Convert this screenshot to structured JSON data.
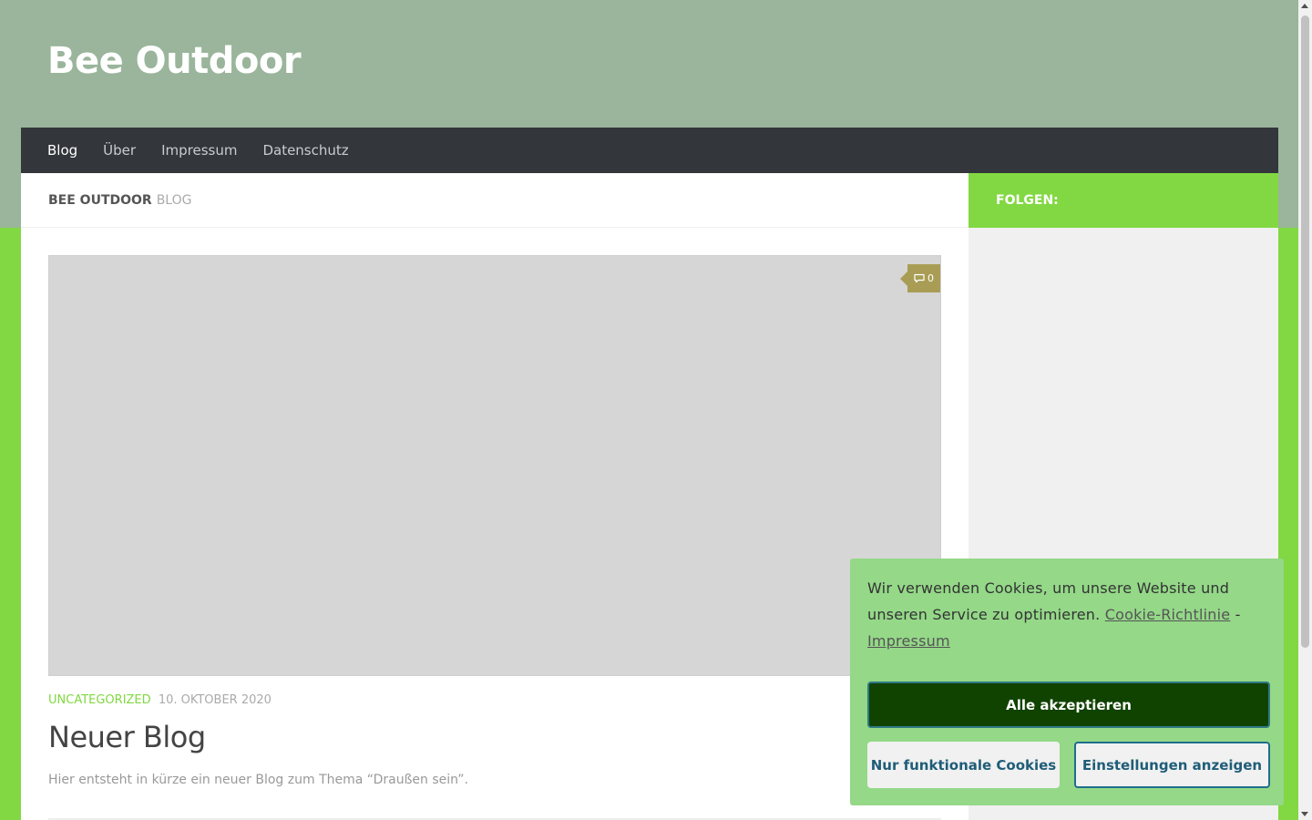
{
  "site": {
    "title": "Bee Outdoor"
  },
  "nav": {
    "items": [
      "Blog",
      "Über",
      "Impressum",
      "Datenschutz"
    ]
  },
  "page_heading": {
    "strong": "Bee Outdoor",
    "light": "Blog"
  },
  "post": {
    "comment_count": "0",
    "category": "Uncategorized",
    "date": "10. Oktober 2020",
    "title": "Neuer Blog",
    "excerpt": "Hier entsteht in kürze ein neuer Blog zum Thema “Draußen sein”."
  },
  "sidebar": {
    "heading": "Folgen:"
  },
  "cookie": {
    "text": "Wir verwenden Cookies, um unsere Website und unseren Service zu optimieren.",
    "policy_link": "Cookie-Richtlinie",
    "separator": "-",
    "imprint_link": "Impressum",
    "accept_label": "Alle akzeptieren",
    "functional_label": "Nur funktionale Cookies",
    "settings_label": "Einstellungen anzeigen"
  },
  "colors": {
    "header": "#9ab59b",
    "accent": "#82d842",
    "nav": "#33363b",
    "cookie_bg": "#94d888",
    "accept_btn": "#104200"
  }
}
